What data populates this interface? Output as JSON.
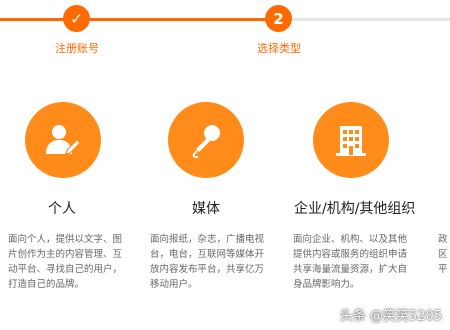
{
  "progress": {
    "step1": {
      "label": "注册账号",
      "mark": "✓"
    },
    "step2": {
      "number": "2",
      "label": "选择类型"
    }
  },
  "cards": [
    {
      "title": "个人",
      "icon": "person-edit-icon",
      "desc": "面向个人，提供以文字、图片创作为主的内容管理、互动平台、寻找自己的用户，打造自己的品牌。"
    },
    {
      "title": "媒体",
      "icon": "microphone-icon",
      "desc": "面向报纸，杂志，广播电视台，电台，互联网等媒体开放内容发布平台，共享亿万移动用户。"
    },
    {
      "title": "企业/机构/其他组织",
      "icon": "building-icon",
      "desc": "面向企业、机构、以及其他提供内容或服务的组织申请共享海量流量资源，扩大自身品牌影响力。"
    }
  ],
  "clipped_column": [
    "政",
    "区",
    "平"
  ],
  "watermark": "头条 @笑笑5205",
  "colors": {
    "accent": "#ff6a00",
    "icon_bg": "#ff8c1a",
    "inactive": "#e5e5e5"
  }
}
